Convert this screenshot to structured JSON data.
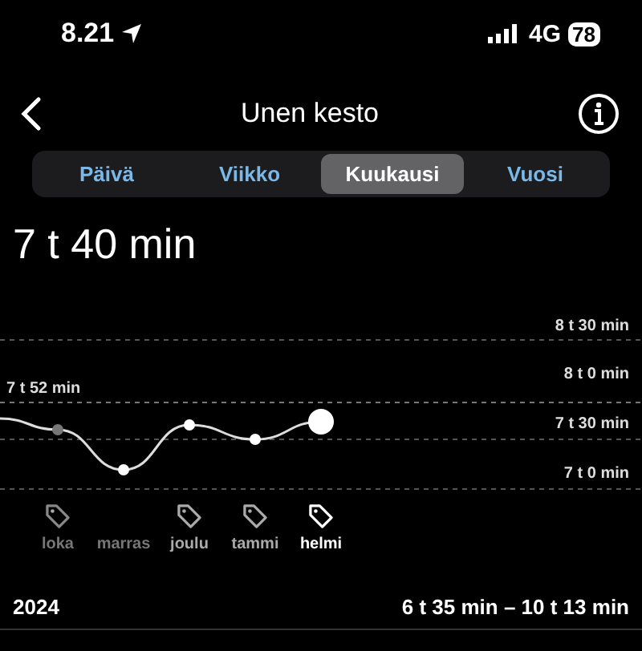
{
  "status_bar": {
    "time": "8.21",
    "network": "4G",
    "battery": "78"
  },
  "nav": {
    "title": "Unen kesto"
  },
  "tabs": [
    {
      "label": "Päivä",
      "selected": false
    },
    {
      "label": "Viikko",
      "selected": false
    },
    {
      "label": "Kuukausi",
      "selected": true
    },
    {
      "label": "Vuosi",
      "selected": false
    }
  ],
  "summary": "7 t 40 min",
  "chart": {
    "y_labels": [
      "8 t 30 min",
      "8 t 0 min",
      "7 t 30 min",
      "7 t 0 min"
    ],
    "average_label": "7 t 52 min"
  },
  "months": [
    {
      "label": "loka",
      "tag": true,
      "selected": false,
      "dim": true,
      "faded_point": true
    },
    {
      "label": "marras",
      "tag": false,
      "selected": false,
      "dim": true,
      "faded_point": false
    },
    {
      "label": "joulu",
      "tag": true,
      "selected": false,
      "dim": false,
      "faded_point": false
    },
    {
      "label": "tammi",
      "tag": true,
      "selected": false,
      "dim": false,
      "faded_point": false
    },
    {
      "label": "helmi",
      "tag": true,
      "selected": true,
      "dim": false,
      "faded_point": false
    }
  ],
  "footer": {
    "year": "2024",
    "range": "6 t 35 min – 10 t 13 min"
  }
}
